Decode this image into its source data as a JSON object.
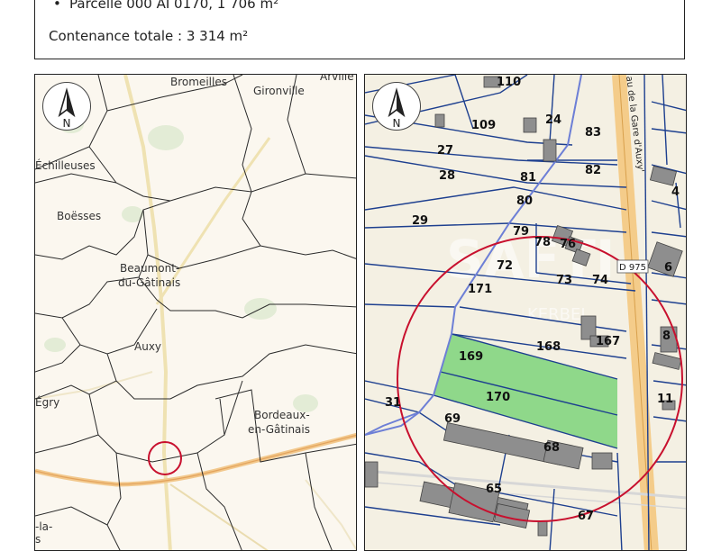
{
  "info": {
    "parcel_line": "Parcelle 000 AI 0170, 1 706 m²",
    "total_line": "Contenance totale : 3 314 m²"
  },
  "left_map": {
    "north_letter": "N",
    "places": {
      "bromeilles": "Bromeilles",
      "gironville": "Gironville",
      "arville": "Arville",
      "echilleuses": "Échilleuses",
      "boesses": "Boësses",
      "beaumont1": "Beaumont-",
      "beaumont2": "du-Gâtinais",
      "auxy": "Auxy",
      "egry": "Égry",
      "bordeaux1": "Bordeaux-",
      "bordeaux2": "en-Gâtinais",
      "bottom_partial1": "-la-",
      "bottom_partial2": "s"
    }
  },
  "right_map": {
    "north_letter": "N",
    "road_sign": "D 975",
    "street_name": "au de la Gare d'Auxy'",
    "watermark": "SAFTI",
    "watermark_sub": "KERBEL",
    "parcels": {
      "p110": "110",
      "p109": "109",
      "p24": "24",
      "p83": "83",
      "p27": "27",
      "p28": "28",
      "p81": "81",
      "p82": "82",
      "p4": "4",
      "p80": "80",
      "p29": "29",
      "p79": "79",
      "p78": "78",
      "p76": "76",
      "p6": "6",
      "p72": "72",
      "p73": "73",
      "p74": "74",
      "p171": "171",
      "p168": "168",
      "p167": "167",
      "p8": "8",
      "p169": "169",
      "p170": "170",
      "p31": "31",
      "p11": "11",
      "p69": "69",
      "p68": "68",
      "p65": "65",
      "p67": "67"
    }
  },
  "colors": {
    "highlight_parcel": "#8fd88a",
    "circle": "#c8102e",
    "parcel_lines": "#1d3f8f",
    "buildings": "#8e8e8e"
  }
}
